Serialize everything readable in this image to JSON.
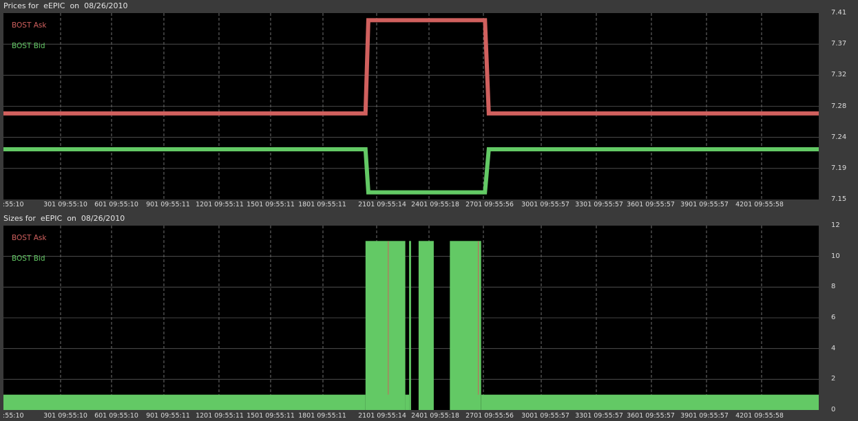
{
  "colors": {
    "ask": "#d0605e",
    "bid": "#63c965",
    "background": "#000000",
    "grid": "#bdbdbd"
  },
  "prices": {
    "title": "Prices for  eEPIC  on  08/26/2010",
    "legend": [
      "BOST Ask",
      "BOST Bid"
    ],
    "y_ticks": [
      "7.41",
      "7.37",
      "7.32",
      "7.28",
      "7.24",
      "7.19",
      "7.15"
    ],
    "x_ticks": [
      ":55:10",
      "301 09:55:10",
      "601 09:55:10",
      "901 09:55:11",
      "1201 09:55:11",
      "1501 09:55:11",
      "1801 09:55:11",
      "2101 09:55:14",
      "2401 09:55:18",
      "2701 09:55:56",
      "3001 09:55:57",
      "3301 09:55:57",
      "3601 09:55:57",
      "3901 09:55:57",
      "4201 09:55:58"
    ]
  },
  "sizes": {
    "title": "Sizes for  eEPIC  on  08/26/2010",
    "legend": [
      "BOST Ask",
      "BOST Bid"
    ],
    "y_ticks": [
      "12",
      "10",
      "8",
      "6",
      "4",
      "2",
      "0"
    ],
    "x_ticks": [
      ":55:10",
      "301 09:55:10",
      "601 09:55:10",
      "901 09:55:11",
      "1201 09:55:11",
      "1501 09:55:11",
      "1801 09:55:11",
      "2101 09:55:14",
      "2401 09:55:18",
      "2701 09:55:56",
      "3001 09:55:57",
      "3301 09:55:57",
      "3601 09:55:57",
      "3901 09:55:57",
      "4201 09:55:58"
    ]
  },
  "chart_data": [
    {
      "type": "line",
      "title": "Prices for  eEPIC  on  08/26/2010",
      "x_domain": [
        1,
        4300
      ],
      "ylim": [
        7.15,
        7.41
      ],
      "grid": true,
      "legend_position": "top-left",
      "series": [
        {
          "name": "BOST Ask",
          "x": [
            1,
            1910,
            1925,
            2540,
            2560,
            4300
          ],
          "y": [
            7.27,
            7.27,
            7.4,
            7.4,
            7.27,
            7.27
          ]
        },
        {
          "name": "BOST Bid",
          "x": [
            1,
            1910,
            1925,
            2540,
            2560,
            4300
          ],
          "y": [
            7.22,
            7.22,
            7.16,
            7.16,
            7.22,
            7.22
          ]
        }
      ]
    },
    {
      "type": "area",
      "title": "Sizes for  eEPIC  on  08/26/2010",
      "x_domain": [
        1,
        4300
      ],
      "ylim": [
        0,
        12
      ],
      "grid": true,
      "legend_position": "top-left",
      "series": [
        {
          "name": "BOST Bid",
          "segments": [
            {
              "x0": 1,
              "x1": 1910,
              "y": 1
            },
            {
              "x0": 1910,
              "x1": 2120,
              "y": 11
            },
            {
              "x0": 2120,
              "x1": 2140,
              "y": 1
            },
            {
              "x0": 2140,
              "x1": 2150,
              "y": 11
            },
            {
              "x0": 2150,
              "x1": 2190,
              "y": 0
            },
            {
              "x0": 2190,
              "x1": 2270,
              "y": 11
            },
            {
              "x0": 2270,
              "x1": 2355,
              "y": 0
            },
            {
              "x0": 2355,
              "x1": 2520,
              "y": 11
            },
            {
              "x0": 2520,
              "x1": 4300,
              "y": 1
            }
          ]
        },
        {
          "name": "BOST Ask",
          "x": [
            2030,
            2505
          ],
          "y": [
            11,
            11
          ]
        }
      ]
    }
  ]
}
